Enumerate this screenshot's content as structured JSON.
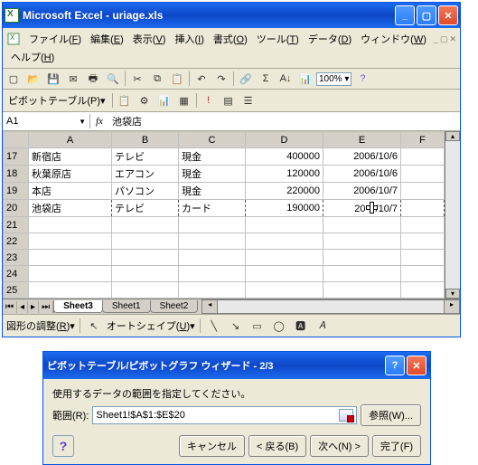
{
  "window": {
    "title": "Microsoft Excel - uriage.xls"
  },
  "menu": {
    "file": "ファイル(",
    "file_k": "F",
    "edit": "編集(",
    "edit_k": "E",
    "view": "表示(",
    "view_k": "V",
    "insert": "挿入(",
    "insert_k": "I",
    "format": "書式(",
    "format_k": "O",
    "tool": "ツール(",
    "tool_k": "T",
    "data": "データ(",
    "data_k": "D",
    "window": "ウィンドウ(",
    "window_k": "W",
    "help": "ヘルプ(",
    "help_k": "H",
    "cp": ")"
  },
  "toolbar": {
    "zoom": "100%"
  },
  "pivot": {
    "label": "ピボットテーブル(",
    "k": "P",
    "cp": ")▾"
  },
  "namebox": {
    "ref": "A1",
    "fx": "fx",
    "val": "池袋店"
  },
  "cols": [
    "A",
    "B",
    "C",
    "D",
    "E",
    "F"
  ],
  "rows": [
    {
      "n": "17",
      "a": "新宿店",
      "b": "テレビ",
      "c": "現金",
      "d": "400000",
      "e": "2006/10/6"
    },
    {
      "n": "18",
      "a": "秋葉原店",
      "b": "エアコン",
      "c": "現金",
      "d": "120000",
      "e": "2006/10/6"
    },
    {
      "n": "19",
      "a": "本店",
      "b": "パソコン",
      "c": "現金",
      "d": "220000",
      "e": "2006/10/7"
    },
    {
      "n": "20",
      "a": "池袋店",
      "b": "テレビ",
      "c": "カード",
      "d": "190000",
      "e": "2006/10/7",
      "dash": true,
      "cursor": true
    }
  ],
  "empty_rows": [
    "21",
    "22",
    "23",
    "24",
    "25"
  ],
  "sheets": {
    "s3": "Sheet3",
    "s1": "Sheet1",
    "s2": "Sheet2"
  },
  "status": {
    "draw": "図形の調整(",
    "draw_k": "R",
    "as": "オートシェイプ(",
    "as_k": "U",
    "cp": ")▾"
  },
  "dialog": {
    "title": "ピボットテーブル/ピボットグラフ ウィザード - 2/3",
    "msg": "使用するデータの範囲を指定してください。",
    "range_lbl": "範囲(",
    "range_k": "R",
    "cp": "):",
    "range_val": "Sheet1!$A$1:$E$20",
    "browse": "参照(",
    "browse_k": "W",
    "browse_cp": ")...",
    "cancel": "キャンセル",
    "back": "< 戻る(",
    "back_k": "B",
    "bcp": ")",
    "next": "次へ(",
    "next_k": "N",
    "ncp": ") >",
    "finish": "完了(",
    "finish_k": "F",
    "fcp": ")"
  }
}
